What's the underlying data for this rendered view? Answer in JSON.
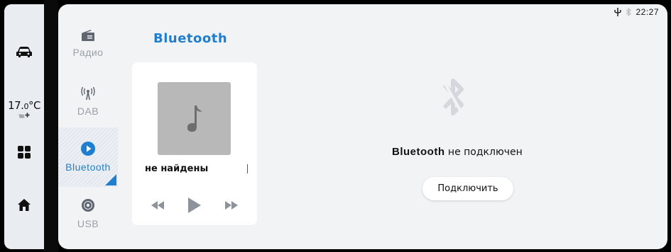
{
  "sidebar": {
    "temperature": "17.",
    "temperature_frac": "0",
    "temperature_unit": "°C",
    "fan_level": "\\\\\\\\\\\\\\"
  },
  "sources": [
    {
      "label": "Радио",
      "icon": "radio-icon"
    },
    {
      "label": "DAB",
      "icon": "antenna-icon"
    },
    {
      "label": "Bluetooth",
      "icon": "play-circle-icon",
      "active": true
    },
    {
      "label": "USB",
      "icon": "disc-icon"
    }
  ],
  "main": {
    "title": "Bluetooth",
    "track_title": "не найдены",
    "status_brand": "Bluetooth",
    "status_text": " не подключен",
    "connect_label": "Подключить"
  },
  "statusbar": {
    "time": "22:27"
  },
  "colors": {
    "accent": "#1e7fd0",
    "panel_bg": "#f2f3f5",
    "sidebar_bg": "#e9edf2",
    "album_art": "#b8b8b8"
  }
}
